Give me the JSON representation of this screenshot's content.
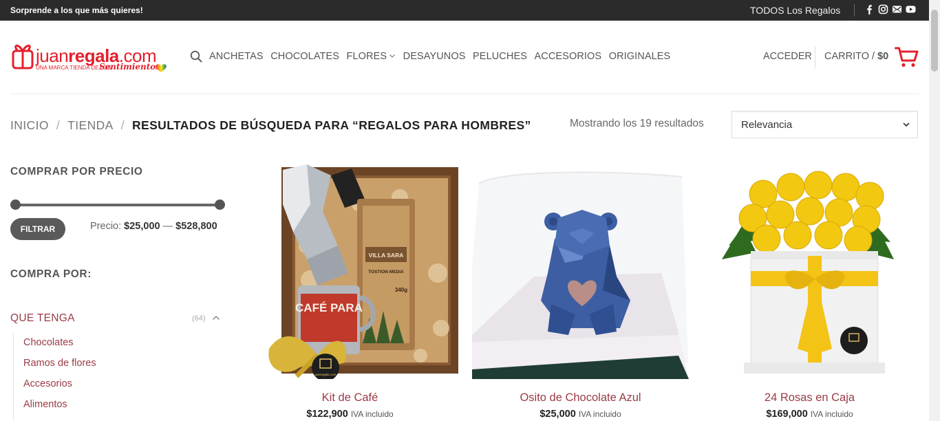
{
  "topbar": {
    "promo": "Sorprende a los que más quieres!",
    "all_gifts": "TODOS Los Regalos",
    "social_icons": [
      "facebook-icon",
      "instagram-icon",
      "mail-icon",
      "youtube-icon"
    ]
  },
  "logo": {
    "brand_light": "juan",
    "brand_bold": "regala",
    "brand_suffix": ".com",
    "tagline": "UNA MARCA TIENDA DE LOS",
    "script": "Sentimientos"
  },
  "nav": {
    "items": [
      "ANCHETAS",
      "CHOCOLATES",
      "FLORES",
      "DESAYUNOS",
      "PELUCHES",
      "ACCESORIOS",
      "ORIGINALES"
    ]
  },
  "account": {
    "login": "ACCEDER",
    "cart_label": "CARRITO",
    "cart_sep": "/",
    "cart_total": "$0"
  },
  "breadcrumb": {
    "home": "INICIO",
    "separator": "/",
    "shop": "TIENDA",
    "current": "RESULTADOS DE BÚSQUEDA PARA “REGALOS PARA HOMBRES”"
  },
  "results": {
    "count_text": "Mostrando los 19 resultados",
    "sort_value": "Relevancia"
  },
  "sidebar": {
    "price_title": "COMPRAR POR PRECIO",
    "filter_button": "FILTRAR",
    "price_prefix": "Precio:",
    "price_min": "$25,000",
    "price_dash": "—",
    "price_max": "$528,800",
    "compra_title": "COMPRA POR:",
    "category": {
      "label": "QUE TENGA",
      "count": "(64)",
      "children": [
        "Chocolates",
        "Ramos de flores",
        "Accesorios",
        "Alimentos"
      ]
    }
  },
  "products": [
    {
      "name": "Kit de Café",
      "price": "$122,900",
      "tax": "IVA incluido"
    },
    {
      "name": "Osito de Chocolate Azul",
      "price": "$25,000",
      "tax": "IVA incluido"
    },
    {
      "name": "24 Rosas en Caja",
      "price": "$169,000",
      "tax": "IVA incluido"
    }
  ],
  "product_image_text": {
    "mug": "CAFÉ PARA",
    "coffee_brand": "VILLA SARA",
    "roast": "TOSTION MEDIA",
    "weight": "340g",
    "seal": "juanregala.com"
  },
  "colors": {
    "brand_red": "#e4202c",
    "link_maroon": "#9a3b45",
    "topbar_bg": "#2b2b2b"
  }
}
